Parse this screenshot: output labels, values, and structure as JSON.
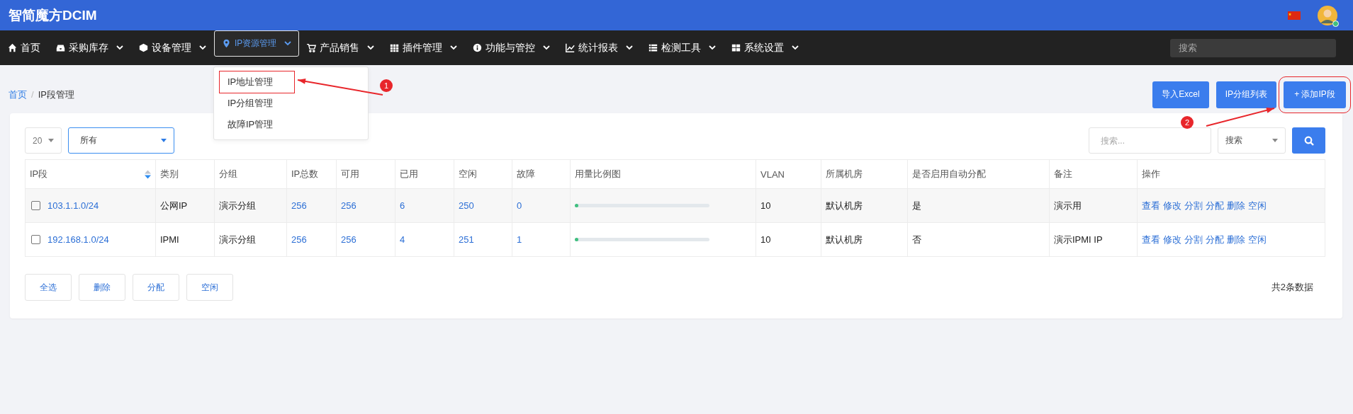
{
  "header": {
    "brand": "智简魔方DCIM",
    "avatar_online": true
  },
  "nav": {
    "items": [
      {
        "label": "首页",
        "has_dropdown": false,
        "selected": false
      },
      {
        "label": "采购库存",
        "has_dropdown": true,
        "selected": false
      },
      {
        "label": "设备管理",
        "has_dropdown": true,
        "selected": false
      },
      {
        "label": "IP资源管理",
        "has_dropdown": true,
        "selected": true
      },
      {
        "label": "产品销售",
        "has_dropdown": true,
        "selected": false
      },
      {
        "label": "插件管理",
        "has_dropdown": true,
        "selected": false
      },
      {
        "label": "功能与管控",
        "has_dropdown": true,
        "selected": false
      },
      {
        "label": "统计报表",
        "has_dropdown": true,
        "selected": false
      },
      {
        "label": "检测工具",
        "has_dropdown": true,
        "selected": false
      },
      {
        "label": "系统设置",
        "has_dropdown": true,
        "selected": false
      }
    ],
    "search": {
      "placeholder": "搜索"
    }
  },
  "dropdown": {
    "items": [
      {
        "label": "IP地址管理",
        "outlined": true
      },
      {
        "label": "IP分组管理",
        "outlined": false
      },
      {
        "label": "故障IP管理",
        "outlined": false
      }
    ]
  },
  "breadcrumb": {
    "separator": "/",
    "items": [
      {
        "label": "首页",
        "link": true
      },
      {
        "label": "IP段管理",
        "link": false
      }
    ]
  },
  "top_buttons": [
    {
      "label": "导入Excel",
      "outlined": false
    },
    {
      "label": "IP分组列表",
      "outlined": false
    },
    {
      "label": "+ 添加IP段",
      "outlined": true
    }
  ],
  "annotations": [
    "1",
    "2"
  ],
  "filters": {
    "page_size": "20",
    "group": "所有",
    "search_placeholder": "搜索...",
    "search_field": "搜索"
  },
  "table": {
    "columns": [
      {
        "label": "IP段",
        "sortable": true
      },
      {
        "label": "类别",
        "sortable": false
      },
      {
        "label": "分组",
        "sortable": false
      },
      {
        "label": "IP总数",
        "sortable": false
      },
      {
        "label": "可用",
        "sortable": false
      },
      {
        "label": "已用",
        "sortable": false
      },
      {
        "label": "空闲",
        "sortable": false
      },
      {
        "label": "故障",
        "sortable": false
      },
      {
        "label": "用量比例图",
        "sortable": false
      },
      {
        "label": "VLAN",
        "sortable": false
      },
      {
        "label": "所属机房",
        "sortable": false
      },
      {
        "label": "是否启用自动分配",
        "sortable": false
      },
      {
        "label": "备注",
        "sortable": false
      },
      {
        "label": "操作",
        "sortable": false
      }
    ],
    "rows": [
      {
        "checked": false,
        "ip": "103.1.1.0/24",
        "type": "公网IP",
        "group": "演示分组",
        "total": "256",
        "available": "256",
        "used": "6",
        "free": "250",
        "fault": "0",
        "level": 0.023,
        "vlan": "10",
        "room": "默认机房",
        "auto_assign": "是",
        "note": "演示用",
        "actions": [
          "查看",
          "修改",
          "分割",
          "分配",
          "删除",
          "空闲"
        ]
      },
      {
        "checked": false,
        "ip": "192.168.1.0/24",
        "type": "IPMI",
        "group": "演示分组",
        "total": "256",
        "available": "256",
        "used": "4",
        "free": "251",
        "fault": "1",
        "level": 0.016,
        "vlan": "10",
        "room": "默认机房",
        "auto_assign": "否",
        "note": "演示IPMI IP",
        "actions": [
          "查看",
          "修改",
          "分割",
          "分配",
          "删除",
          "空闲"
        ]
      }
    ]
  },
  "bulk_buttons": [
    "全选",
    "删除",
    "分配",
    "空闲"
  ],
  "total": "共2条数据"
}
